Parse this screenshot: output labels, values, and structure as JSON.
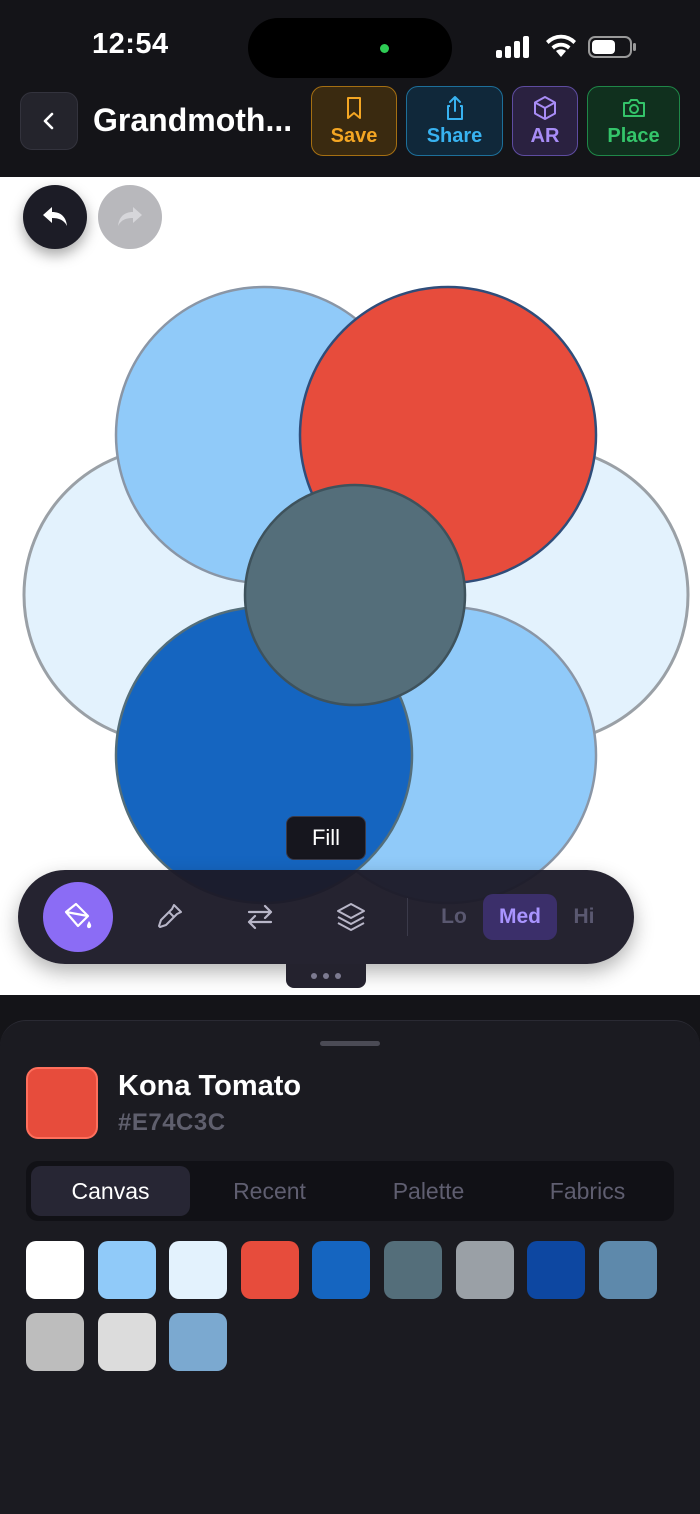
{
  "status": {
    "time": "12:54"
  },
  "topbar": {
    "title": "Grandmoth...",
    "actions": [
      {
        "label": "Save",
        "icon": "bookmark-icon"
      },
      {
        "label": "Share",
        "icon": "share-icon"
      },
      {
        "label": "AR",
        "icon": "cube-icon"
      },
      {
        "label": "Place",
        "icon": "camera-icon"
      }
    ]
  },
  "canvas": {
    "tooltip": "Fill",
    "quality": [
      "Lo",
      "Med",
      "Hi"
    ],
    "quality_selected": "Med",
    "tools": [
      "fill-tool",
      "eyedropper-tool",
      "swap-tool",
      "layers-tool"
    ],
    "shapes": [
      {
        "name": "left-petal",
        "color": "#E3F2FD"
      },
      {
        "name": "right-petal",
        "color": "#E3F2FD"
      },
      {
        "name": "top-left-petal",
        "color": "#90CAF9"
      },
      {
        "name": "bottom-right-petal",
        "color": "#90CAF9"
      },
      {
        "name": "bottom-left-petal",
        "color": "#1565C0"
      },
      {
        "name": "top-right-petal",
        "color": "#E74C3C"
      },
      {
        "name": "center-circle",
        "color": "#546E7A"
      }
    ]
  },
  "sheet": {
    "selected_color_name": "Kona Tomato",
    "selected_color_hex": "#E74C3C",
    "tabs": [
      "Canvas",
      "Recent",
      "Palette",
      "Fabrics"
    ],
    "active_tab": "Canvas",
    "swatches": [
      "#FFFFFF",
      "#90CAF9",
      "#E3F2FD",
      "#E74C3C",
      "#1565C0",
      "#546E7A",
      "#9AA0A6",
      "#0D47A1",
      "#5E89AB",
      "#BDBDBD",
      "#DCDCDC",
      "#7BA9D0"
    ]
  }
}
